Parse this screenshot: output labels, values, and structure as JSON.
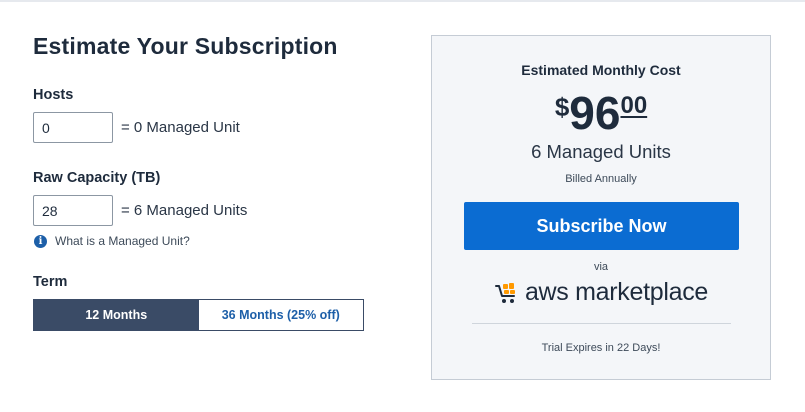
{
  "estimator": {
    "title": "Estimate Your Subscription",
    "hosts": {
      "label": "Hosts",
      "value": "0",
      "equivalent": "= 0 Managed Unit"
    },
    "raw_capacity": {
      "label": "Raw Capacity (TB)",
      "value": "28",
      "equivalent": "= 6 Managed Units"
    },
    "info_link": "What is a Managed Unit?",
    "term": {
      "label": "Term",
      "options": [
        "12 Months",
        "36 Months (25% off)"
      ],
      "selected": "12 Months"
    }
  },
  "summary": {
    "heading": "Estimated Monthly Cost",
    "currency": "$",
    "price_whole": "96",
    "price_cents": "00",
    "units": "6 Managed Units",
    "billing": "Billed Annually",
    "subscribe_label": "Subscribe Now",
    "via": "via",
    "marketplace": "aws marketplace",
    "trial": "Trial Expires in 22 Days!"
  },
  "colors": {
    "primary_blue": "#0b6cd2",
    "selected_term": "#3a4b66",
    "panel_bg": "#f4f6f9"
  }
}
